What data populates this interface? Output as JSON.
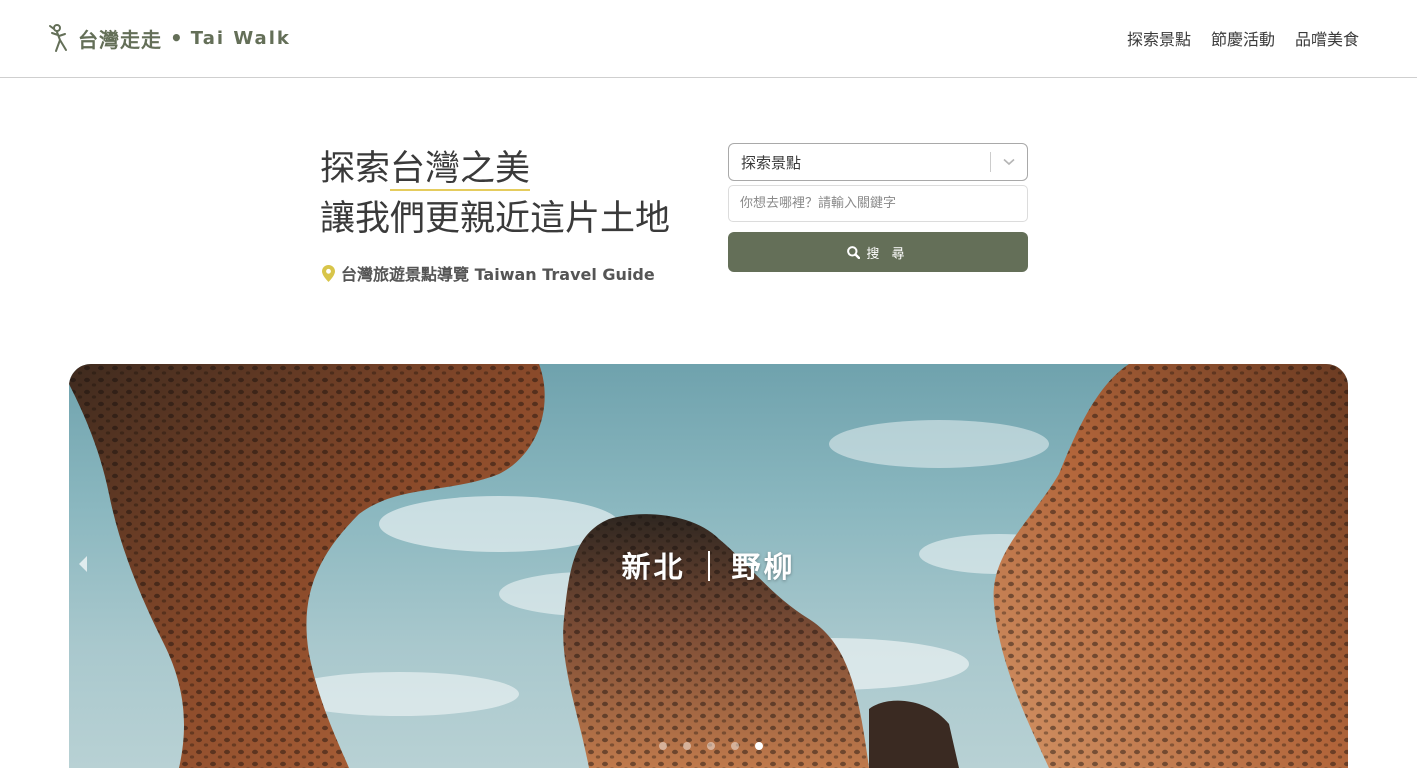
{
  "header": {
    "logo_cn": "台灣走走",
    "logo_dot": "•",
    "logo_en": "Tai Walk",
    "nav": [
      {
        "label": "探索景點"
      },
      {
        "label": "節慶活動"
      },
      {
        "label": "品嚐美食"
      }
    ]
  },
  "hero": {
    "title_part1": "探索",
    "title_highlight": "台灣之美",
    "title_line2": "讓我們更親近這片土地",
    "tagline": "台灣旅遊景點導覽 Taiwan Travel Guide"
  },
  "search": {
    "category_value": "探索景點",
    "keyword_value": "",
    "keyword_placeholder": "你想去哪裡？請輸入關鍵字",
    "button_label": "搜 尋"
  },
  "carousel": {
    "city": "新北",
    "spot": "野柳",
    "slide_count": 5,
    "active_index": 4
  },
  "colors": {
    "brand": "#646f58",
    "accent": "#e5cc5d"
  },
  "icons": [
    "logo-walker-icon",
    "map-pin-icon",
    "chevron-down-icon",
    "search-icon",
    "prev-arrow-icon"
  ]
}
